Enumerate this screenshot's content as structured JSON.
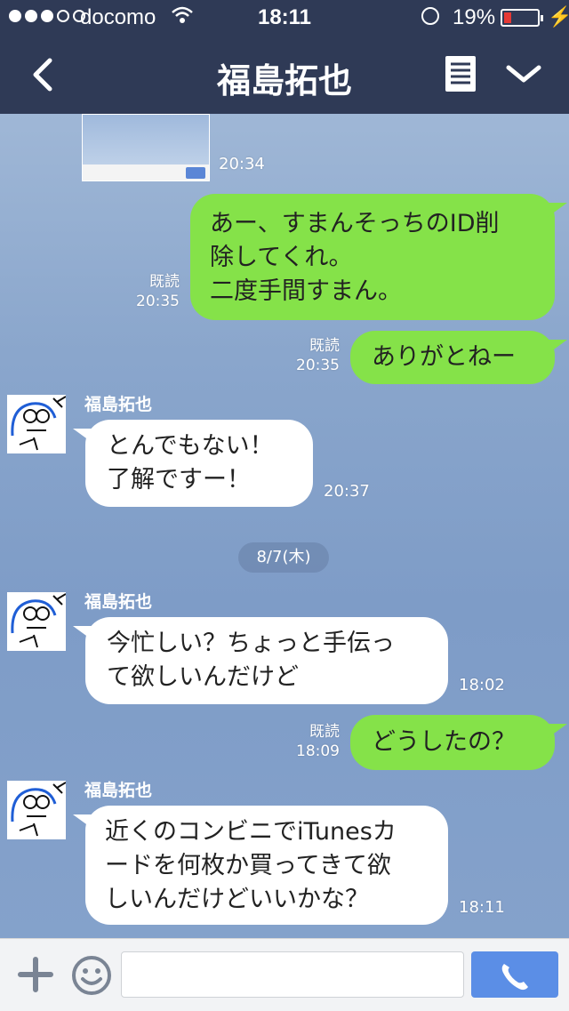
{
  "status_bar": {
    "carrier": "docomo",
    "time": "18:11",
    "battery": "19%",
    "signal_bars_filled": 3,
    "signal_bars_total": 5
  },
  "nav": {
    "title": "福島拓也",
    "back_icon": "chevron-left-icon",
    "notes_icon": "list-icon",
    "menu_icon": "chevron-down-icon"
  },
  "messages": {
    "img_time": "20:34",
    "m1": {
      "lines": [
        "あー、すまんそっちのID削",
        "除してくれ。",
        "二度手間すまん。"
      ],
      "read": "既読",
      "time": "20:35"
    },
    "m2": {
      "text": "ありがとねー",
      "read": "既読",
      "time": "20:35"
    },
    "m3": {
      "sender": "福島拓也",
      "lines": [
        "とんでもない！",
        "了解ですー！"
      ],
      "time": "20:37"
    },
    "date": "8/7(木)",
    "m4": {
      "sender": "福島拓也",
      "lines": [
        "今忙しい？ちょっと手伝っ",
        "て欲しいんだけど"
      ],
      "time": "18:02"
    },
    "m5": {
      "text": "どうしたの？",
      "read": "既読",
      "time": "18:09"
    },
    "m6": {
      "sender": "福島拓也",
      "lines": [
        "近くのコンビニでiTunesカ",
        "ードを何枚か買ってきて欲",
        "しいんだけどいいかな？"
      ],
      "time": "18:11"
    }
  },
  "colors": {
    "nav_bg": "#2f3a56",
    "my_bubble": "#85e249",
    "their_bubble": "#ffffff",
    "send_button": "#5b8ee6"
  }
}
